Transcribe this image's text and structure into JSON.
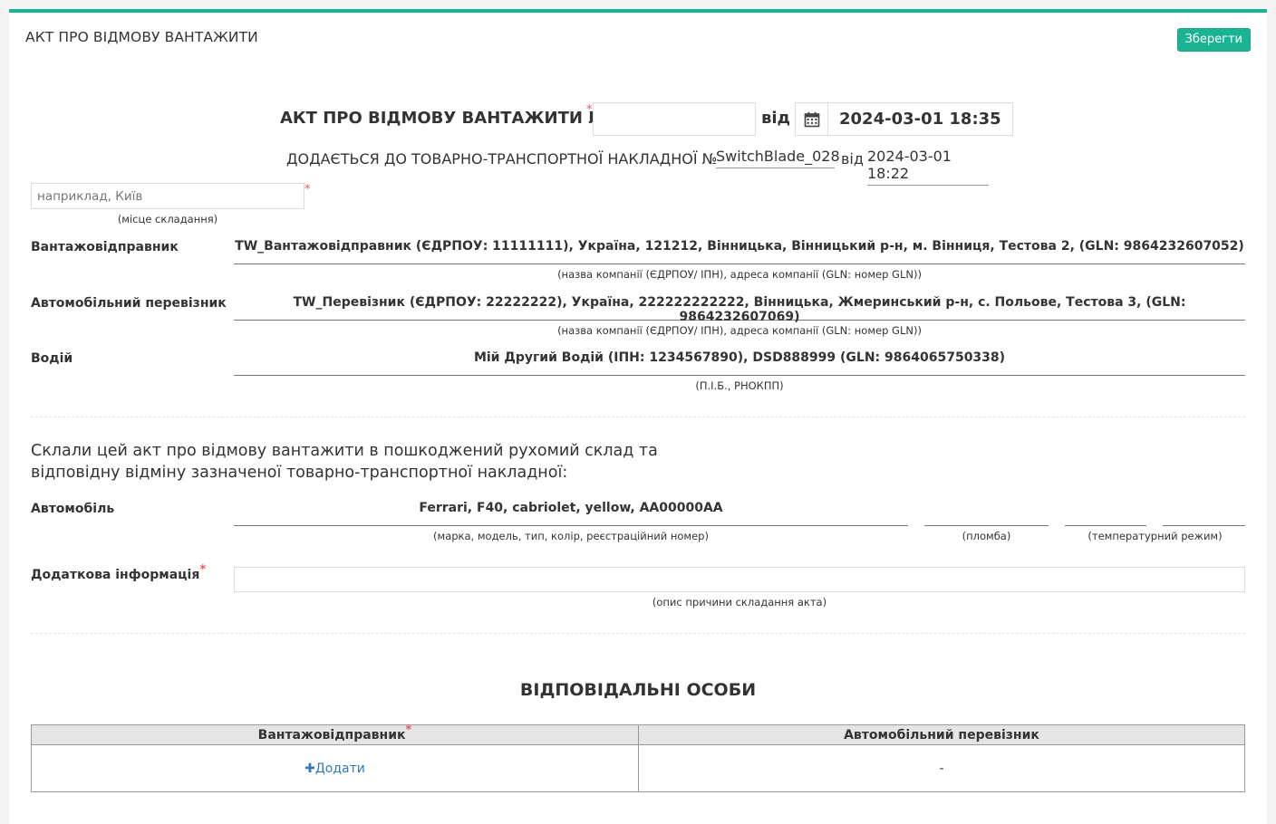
{
  "header": {
    "title": "АКТ ПРО ВІДМОВУ ВАНТАЖИТИ",
    "save_label": "Зберегти"
  },
  "document": {
    "title_prefix": "АКТ ПРО ВІДМОВУ ВАНТАЖИТИ №",
    "number_value": "",
    "from_label": "від",
    "date_value": "2024-03-01 18:35",
    "attached_label": "ДОДАЄТЬСЯ ДО ТОВАРНО-ТРАНСПОРТНОЇ НАКЛАДНОЇ №",
    "waybill_number": "SwitchBlade_028",
    "waybill_from_label": "від",
    "waybill_date": "2024-03-01 18:22",
    "place_placeholder": "наприклад, Київ",
    "place_hint": "(місце складання)"
  },
  "parties": {
    "consignor_label": "Вантажовідправник",
    "consignor_value": "TW_Вантажовідправник (ЄДРПОУ: 11111111), Україна, 121212, Вінницька, Вінницький р-н, м. Вінниця, Тестова 2, (GLN: 9864232607052)",
    "consignor_hint": "(назва компанії (ЄДРПОУ/ ІПН), адреса компанії (GLN: номер GLN))",
    "carrier_label": "Автомобільний перевізник",
    "carrier_value": "TW_Перевізник (ЄДРПОУ: 22222222), Україна, 222222222222, Вінницька, Жмеринський р-н, с. Польове, Тестова 3, (GLN: 9864232607069)",
    "carrier_hint": "(назва компанії (ЄДРПОУ/ ІПН), адреса компанії (GLN: номер GLN))",
    "driver_label": "Водій",
    "driver_value": "Мій Другий Водій (ІПН: 1234567890), DSD888999 (GLN: 9864065750338)",
    "driver_hint": "(П.І.Б., РНОКПП)"
  },
  "statement": {
    "line1": "Склали цей акт про відмову вантажити в пошкоджений рухомий склад та",
    "line2": "відповідну відміну зазначеної товарно-транспортної накладної:"
  },
  "vehicle": {
    "label": "Автомобіль",
    "value": "Ferrari, F40, cabriolet, yellow, AA00000AA",
    "hint": "(марка, модель, тип, колір, реєстраційний номер)",
    "seal_value": "",
    "seal_hint": "(пломба)",
    "temp_value_1": "",
    "temp_value_2": "",
    "temp_hint": "(температурний режим)"
  },
  "additional": {
    "label": "Додаткова інформація",
    "value": "",
    "hint": "(опис причини складання акта)"
  },
  "responsible": {
    "title": "ВІДПОВІДАЛЬНІ ОСОБИ",
    "col_consignor": "Вантажовідправник",
    "col_carrier": "Автомобільний перевізник",
    "add_label": "Додати",
    "carrier_value": "-"
  },
  "required_mark": "*",
  "icons": {
    "calendar": "calendar-icon",
    "plus": "plus-icon"
  },
  "colors": {
    "accent": "#1ab394",
    "required": "#ed5565",
    "link": "#337ab7"
  }
}
